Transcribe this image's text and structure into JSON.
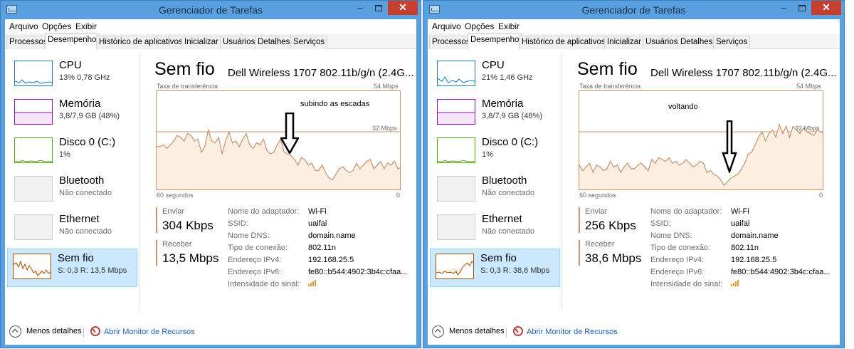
{
  "colors": {
    "window_frame": "#59a0e0",
    "close_button": "#c7402f",
    "graph_line": "#c8936a",
    "graph_fill": "#fdeee2",
    "selected_item": "#cce8ff",
    "cpu": "#117dbb",
    "memory": "#8b12ae",
    "disk": "#4da60c",
    "network": "#a74f01",
    "link": "#1e5fb6"
  },
  "windows": [
    {
      "title": "Gerenciador de Tarefas",
      "controls": {
        "minimize": "–",
        "close": "✕"
      },
      "menu": [
        "Arquivo",
        "Opções",
        "Exibir"
      ],
      "tabs": [
        "Processos",
        "Desempenho",
        "Histórico de aplicativos",
        "Inicializar",
        "Usuários",
        "Detalhes",
        "Serviços"
      ],
      "active_tab": "Desempenho",
      "sidebar": [
        {
          "name": "CPU",
          "value": "13% 0,78 GHz",
          "icon": "cpu-graph-icon"
        },
        {
          "name": "Memória",
          "value": "3,8/7,9 GB (48%)",
          "icon": "memory-graph-icon"
        },
        {
          "name": "Disco 0 (C:)",
          "value": "1%",
          "icon": "disk-graph-icon"
        },
        {
          "name": "Bluetooth",
          "value": "Não conectado",
          "icon": "bluetooth-graph-icon"
        },
        {
          "name": "Ethernet",
          "value": "Não conectado",
          "icon": "ethernet-graph-icon"
        },
        {
          "name": "Sem fio",
          "value": "S: 0,3 R: 13,5 Mbps",
          "icon": "wifi-graph-icon",
          "selected": true
        }
      ],
      "detail": {
        "title": "Sem fio",
        "adapter": "Dell Wireless 1707 802.11b/g/n (2.4G...",
        "graph_label": "Taxa de transferência",
        "max_label": "54 Mbps",
        "mid_label": "32 Mbps",
        "time_label": "60 segundos",
        "zero_label": "0",
        "annotation": "subindo as escadas",
        "send_label": "Enviar",
        "send_value": "304 Kbps",
        "receive_label": "Receber",
        "receive_value": "13,5 Mbps",
        "properties": [
          {
            "label": "Nome do adaptador:",
            "value": "Wi-Fi"
          },
          {
            "label": "SSID:",
            "value": "uaifai"
          },
          {
            "label": "Nome DNS:",
            "value": "domain.name"
          },
          {
            "label": "Tipo de conexão:",
            "value": "802.11n"
          },
          {
            "label": "Endereço IPv4:",
            "value": "192.168.25.5"
          },
          {
            "label": "Endereço IPv6:",
            "value": "fe80::b544:4902:3b4c:cfaa..."
          },
          {
            "label": "Intensidade do sinal:",
            "value": ""
          }
        ],
        "signal_bars": 4,
        "throughput_mbps": [
          24,
          24,
          25,
          23,
          25,
          27,
          30,
          29,
          27,
          31,
          30,
          27,
          28,
          21,
          24,
          33,
          27,
          26,
          29,
          20,
          27,
          32,
          26,
          27,
          24,
          28,
          31,
          25,
          23,
          26,
          25,
          28,
          22,
          20,
          21,
          25,
          28,
          21,
          20,
          19,
          17,
          14,
          18,
          17,
          14,
          15,
          11,
          11,
          14,
          10,
          7,
          6,
          9,
          12,
          13,
          11,
          10,
          11,
          15,
          12,
          14,
          16,
          17,
          12,
          14,
          16,
          12,
          15,
          14,
          16,
          12,
          13
        ]
      },
      "footer": {
        "fewer_details": "Menos detalhes",
        "open_monitor": "Abrir Monitor de Recursos"
      }
    },
    {
      "title": "Gerenciador de Tarefas",
      "controls": {
        "minimize": "–",
        "close": "✕"
      },
      "menu": [
        "Arquivo",
        "Opções",
        "Exibir"
      ],
      "tabs": [
        "Processos",
        "Desempenho",
        "Histórico de aplicativos",
        "Inicializar",
        "Usuários",
        "Detalhes",
        "Serviços"
      ],
      "active_tab": "Desempenho",
      "sidebar": [
        {
          "name": "CPU",
          "value": "21% 1,46 GHz",
          "icon": "cpu-graph-icon"
        },
        {
          "name": "Memória",
          "value": "3,8/7,9 GB (48%)",
          "icon": "memory-graph-icon"
        },
        {
          "name": "Disco 0 (C:)",
          "value": "1%",
          "icon": "disk-graph-icon"
        },
        {
          "name": "Bluetooth",
          "value": "Não conectado",
          "icon": "bluetooth-graph-icon"
        },
        {
          "name": "Ethernet",
          "value": "Não conectado",
          "icon": "ethernet-graph-icon"
        },
        {
          "name": "Sem fio",
          "value": "S: 0,3 R: 38,6 Mbps",
          "icon": "wifi-graph-icon",
          "selected": true
        }
      ],
      "detail": {
        "title": "Sem fio",
        "adapter": "Dell Wireless 1707 802.11b/g/n (2.4G...",
        "graph_label": "Taxa de transferência",
        "max_label": "54 Mbps",
        "mid_label": "32 Mbps",
        "time_label": "60 segundos",
        "zero_label": "0",
        "annotation": "voltando",
        "send_label": "Enviar",
        "send_value": "256 Kbps",
        "receive_label": "Receber",
        "receive_value": "38,6 Mbps",
        "properties": [
          {
            "label": "Nome do adaptador:",
            "value": "Wi-Fi"
          },
          {
            "label": "SSID:",
            "value": "uaifai"
          },
          {
            "label": "Nome DNS:",
            "value": "domain.name"
          },
          {
            "label": "Tipo de conexão:",
            "value": "802.11n"
          },
          {
            "label": "Endereço IPv4:",
            "value": "192.168.25.5"
          },
          {
            "label": "Endereço IPv6:",
            "value": "fe80::b544:4902:3b4c:cfaa..."
          },
          {
            "label": "Intensidade do sinal:",
            "value": ""
          }
        ],
        "signal_bars": 4,
        "throughput_mbps": [
          14,
          11,
          13,
          15,
          10,
          14,
          13,
          11,
          12,
          16,
          13,
          14,
          10,
          13,
          15,
          12,
          12,
          14,
          15,
          13,
          11,
          17,
          15,
          18,
          17,
          16,
          18,
          15,
          16,
          14,
          15,
          17,
          15,
          13,
          14,
          16,
          15,
          10,
          11,
          9,
          8,
          6,
          3,
          5,
          7,
          8,
          9,
          12,
          15,
          20,
          21,
          25,
          29,
          32,
          27,
          31,
          33,
          29,
          36,
          31,
          35,
          29,
          35,
          33,
          31,
          34,
          32,
          31,
          30,
          33,
          32,
          31
        ]
      },
      "footer": {
        "fewer_details": "Menos detalhes",
        "open_monitor": "Abrir Monitor de Recursos"
      }
    }
  ]
}
